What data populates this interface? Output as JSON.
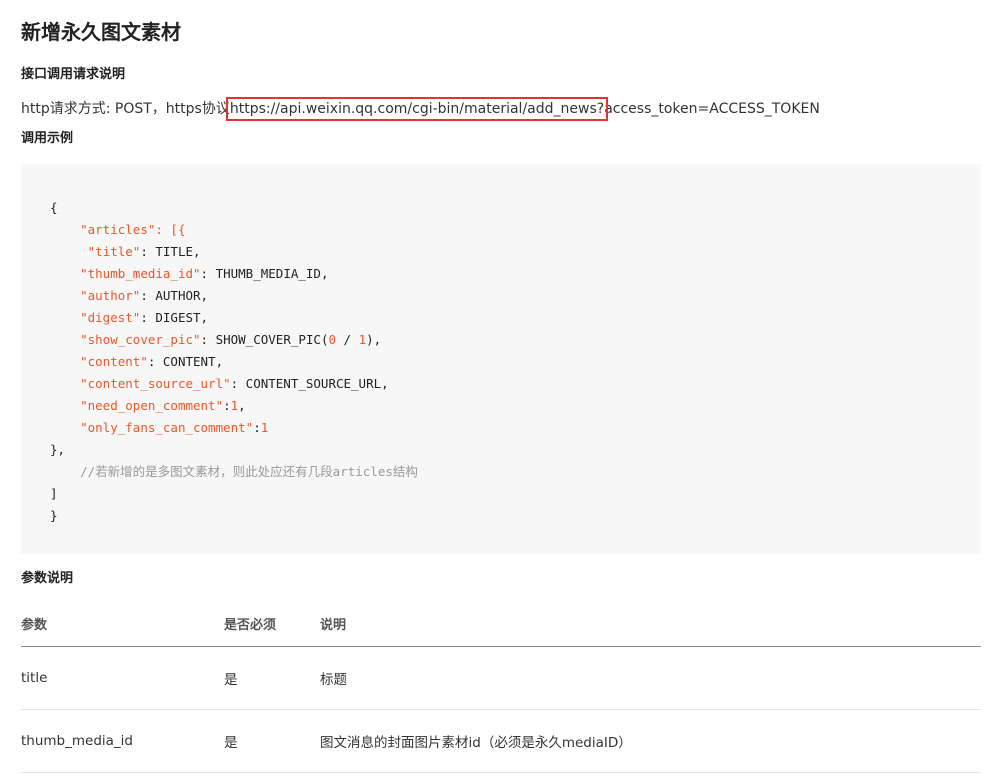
{
  "page_title": "新增永久图文素材",
  "section_request": "接口调用请求说明",
  "request": {
    "prefix": "http请求方式: POST，https协议",
    "url_highlighted": "https://api.weixin.qq.com/cgi-bin/material/add_news?",
    "url_suffix": "access_token=ACCESS_TOKEN"
  },
  "section_example": "调用示例",
  "code": {
    "open_brace": "{",
    "articles_key": "\"articles\"",
    "articles_open": ": [{",
    "title_key": "\"title\"",
    "title_val": ": TITLE,",
    "thumb_key": "\"thumb_media_id\"",
    "thumb_val": ": THUMB_MEDIA_ID,",
    "author_key": "\"author\"",
    "author_val": ": AUTHOR,",
    "digest_key": "\"digest\"",
    "digest_val": ": DIGEST,",
    "cover_key": "\"show_cover_pic\"",
    "cover_val_a": ": SHOW_COVER_PIC(",
    "cover_zero": "0",
    "cover_sep": " / ",
    "cover_one": "1",
    "cover_val_b": "),",
    "content_key": "\"content\"",
    "content_val": ": CONTENT,",
    "source_key": "\"content_source_url\"",
    "source_val": ": CONTENT_SOURCE_URL,",
    "open_comment_key": "\"need_open_comment\"",
    "open_comment_colon": ":",
    "open_comment_num": "1",
    "open_comment_comma": ",",
    "fans_key": "\"only_fans_can_comment\"",
    "fans_colon": ":",
    "fans_num": "1",
    "close_item": "},",
    "comment": "//若新增的是多图文素材，则此处应还有几段articles结构",
    "close_bracket": "]",
    "close_brace": "}"
  },
  "section_params": "参数说明",
  "params_table": {
    "headers": [
      "参数",
      "是否必须",
      "说明"
    ],
    "rows": [
      [
        "title",
        "是",
        "标题"
      ],
      [
        "thumb_media_id",
        "是",
        "图文消息的封面图片素材id（必须是永久mediaID）"
      ]
    ]
  },
  "colors": {
    "highlight_box": "#e53333",
    "code_key": "#e8572c",
    "code_comment": "#999999",
    "code_bg": "#f7f7f7"
  }
}
